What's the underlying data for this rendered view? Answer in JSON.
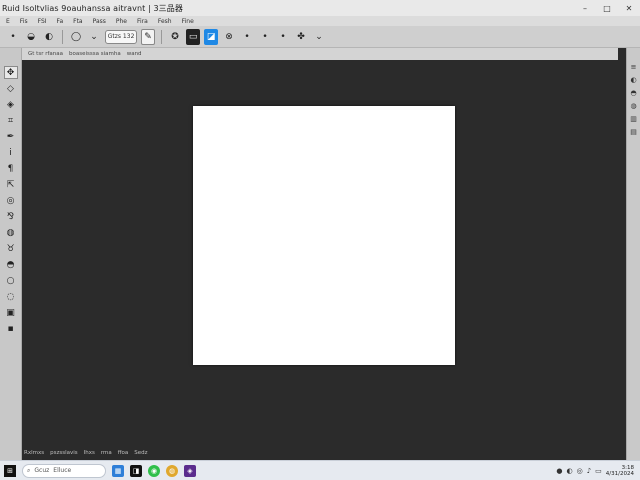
{
  "window": {
    "title": "Ruid Isoltvlias  9oauhanssa aitravnt  |  3三品器",
    "controls": [
      "–",
      "□",
      "✕"
    ]
  },
  "menu": {
    "items": [
      "E",
      "Fis",
      "FSI",
      "Fa",
      "Fta",
      "Pass",
      "Phe",
      "Fira",
      "Fesh",
      "Fine"
    ]
  },
  "options": {
    "tool_icon": "•",
    "shape_a": "◒",
    "shape_b": "◐",
    "brush_size": "◯",
    "style_field": "Gtzs 132",
    "pen_btn": "✎",
    "icon_1": "✪",
    "icon_2": "▭",
    "icon_3": "◪",
    "icon_4": "⊗",
    "icon_5": "•",
    "icon_6": "•",
    "icon_7": "•",
    "icon_8": "✤",
    "chev": "⌄"
  },
  "tabs": {
    "items": [
      "Gt  tsr  rfanaa",
      "boaseisssa  siamha",
      "wand"
    ]
  },
  "tools": [
    {
      "name": "move-tool-icon",
      "glyph": "✥"
    },
    {
      "name": "lasso-tool-icon",
      "glyph": "◇"
    },
    {
      "name": "quick-select-tool-icon",
      "glyph": "◈"
    },
    {
      "name": "crop-tool-icon",
      "glyph": "⌗"
    },
    {
      "name": "eyedropper-tool-icon",
      "glyph": "✒"
    },
    {
      "name": "brush-tool-icon",
      "glyph": "ⅰ"
    },
    {
      "name": "stamp-tool-icon",
      "glyph": "¶"
    },
    {
      "name": "history-brush-tool-icon",
      "glyph": "⇱"
    },
    {
      "name": "eraser-tool-icon",
      "glyph": "◎"
    },
    {
      "name": "gradient-tool-icon",
      "glyph": "⅋"
    },
    {
      "name": "dodge-tool-icon",
      "glyph": "◍"
    },
    {
      "name": "pen-tool-icon",
      "glyph": "♉"
    },
    {
      "name": "type-tool-icon",
      "glyph": "◓"
    },
    {
      "name": "path-select-tool-icon",
      "glyph": "○"
    },
    {
      "name": "shape-tool-icon",
      "glyph": "◌"
    },
    {
      "name": "hand-tool-icon",
      "glyph": "▣"
    },
    {
      "name": "zoom-tool-icon",
      "glyph": "▪"
    }
  ],
  "right_panel": [
    "≡",
    "◐",
    "◓",
    "◍",
    "▥",
    "▤"
  ],
  "status": {
    "items": [
      "Rxlmxs",
      "pszsslavis",
      "Ihxs",
      "rma",
      "ffoa",
      "Sedz"
    ]
  },
  "taskbar": {
    "start_glyph": "⊞",
    "search_text": "Gcuz",
    "search_text2": "Elluce",
    "apps": [
      {
        "name": "file-explorer-icon",
        "glyph": "▦",
        "color": "#2f7fd8"
      },
      {
        "name": "photoshop-icon",
        "glyph": "◨",
        "color": "#111111"
      },
      {
        "name": "whatsapp-icon",
        "glyph": "◉",
        "color": "#2fbf4a"
      },
      {
        "name": "chrome-icon",
        "glyph": "◍",
        "color": "#e0a82e"
      },
      {
        "name": "media-app-icon",
        "glyph": "◈",
        "color": "#5b2c8d"
      }
    ],
    "tray": [
      "●",
      "◐",
      "◎",
      "♪",
      "▭"
    ],
    "time": "3:18",
    "date": "4/31/2024"
  },
  "colors": {
    "workspace": "#2b2b2b",
    "canvas": "#ffffff",
    "chrome": "#cfcfcf"
  }
}
